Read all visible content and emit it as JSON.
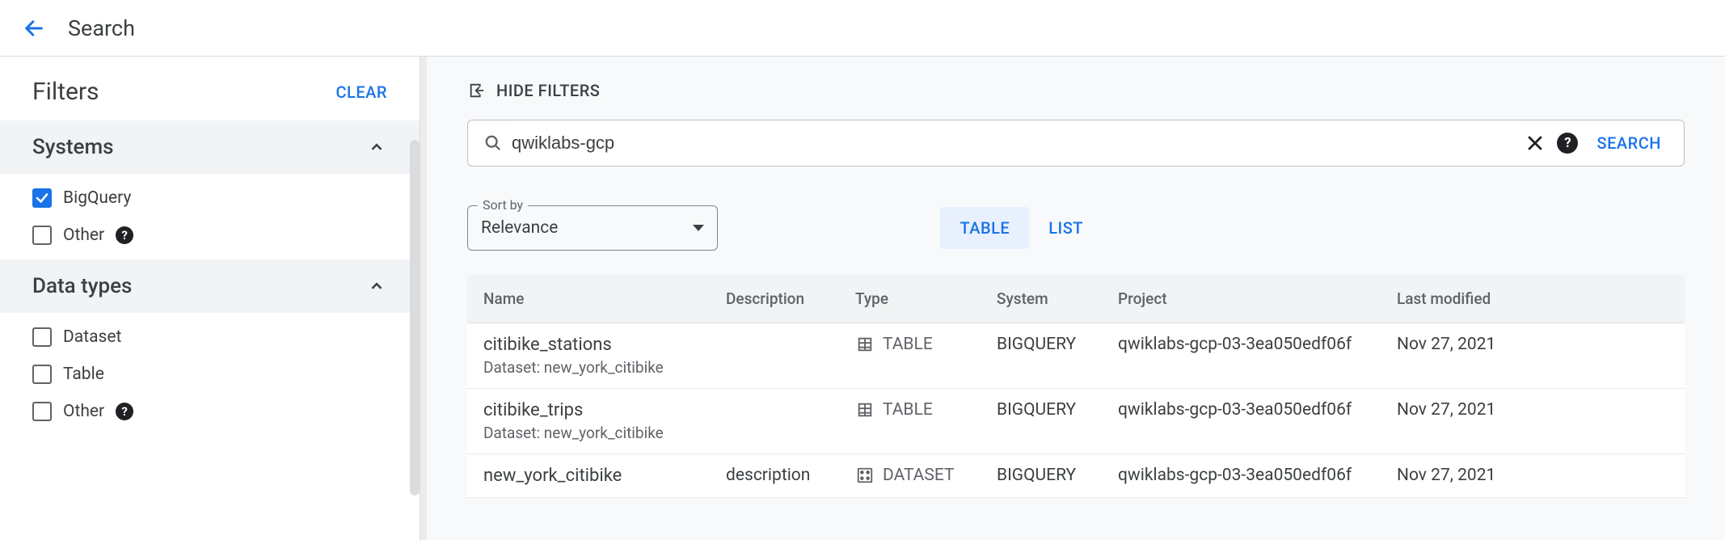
{
  "header": {
    "title": "Search"
  },
  "sidebar": {
    "title": "Filters",
    "clear_label": "CLEAR",
    "sections": [
      {
        "title": "Systems",
        "expanded": true,
        "options": [
          {
            "label": "BigQuery",
            "checked": true,
            "help": false
          },
          {
            "label": "Other",
            "checked": false,
            "help": true
          }
        ]
      },
      {
        "title": "Data types",
        "expanded": true,
        "options": [
          {
            "label": "Dataset",
            "checked": false,
            "help": false
          },
          {
            "label": "Table",
            "checked": false,
            "help": false
          },
          {
            "label": "Other",
            "checked": false,
            "help": true
          }
        ]
      }
    ]
  },
  "main": {
    "hide_filters_label": "HIDE FILTERS",
    "search": {
      "value": "qwiklabs-gcp",
      "search_label": "SEARCH"
    },
    "sort": {
      "label": "Sort by",
      "value": "Relevance"
    },
    "view_toggle": {
      "table": "TABLE",
      "list": "LIST",
      "active": "table"
    },
    "table": {
      "columns": {
        "name": "Name",
        "description": "Description",
        "type": "Type",
        "system": "System",
        "project": "Project",
        "last_modified": "Last modified"
      },
      "rows": [
        {
          "name": "citibike_stations",
          "subtitle": "Dataset: new_york_citibike",
          "description": "",
          "type": "TABLE",
          "type_kind": "table",
          "system": "BIGQUERY",
          "project": "qwiklabs-gcp-03-3ea050edf06f",
          "last_modified": "Nov 27, 2021"
        },
        {
          "name": "citibike_trips",
          "subtitle": "Dataset: new_york_citibike",
          "description": "",
          "type": "TABLE",
          "type_kind": "table",
          "system": "BIGQUERY",
          "project": "qwiklabs-gcp-03-3ea050edf06f",
          "last_modified": "Nov 27, 2021"
        },
        {
          "name": "new_york_citibike",
          "subtitle": "",
          "description": "description",
          "type": "DATASET",
          "type_kind": "dataset",
          "system": "BIGQUERY",
          "project": "qwiklabs-gcp-03-3ea050edf06f",
          "last_modified": "Nov 27, 2021"
        }
      ]
    }
  }
}
